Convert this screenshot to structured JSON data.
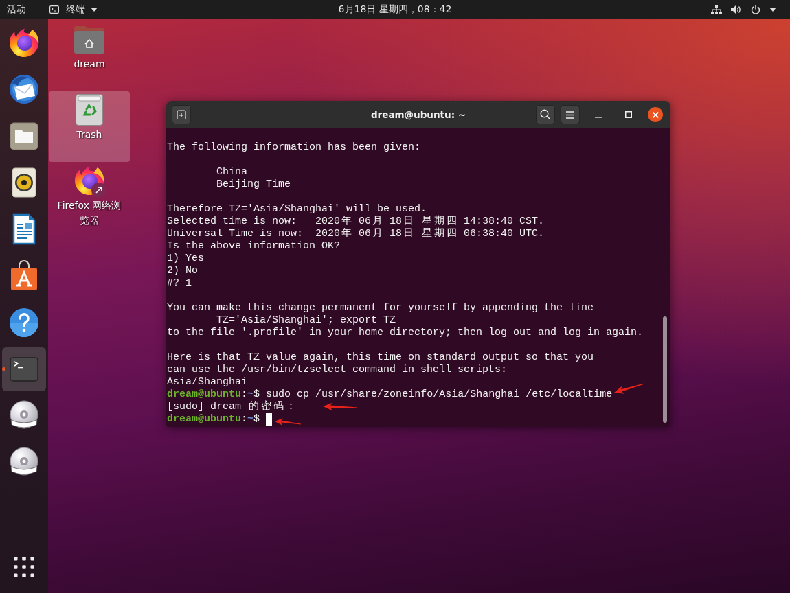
{
  "top_bar": {
    "activities": "活动",
    "app_menu": "终端",
    "clock": "6月18日 星期四，08：42"
  },
  "dock": {
    "items": [
      {
        "running": false,
        "focused": false
      },
      {
        "running": false,
        "focused": false
      },
      {
        "running": false,
        "focused": false
      },
      {
        "running": false,
        "focused": false
      },
      {
        "running": false,
        "focused": false
      },
      {
        "running": false,
        "focused": false
      },
      {
        "running": false,
        "focused": false
      },
      {
        "running": true,
        "focused": true
      },
      {
        "running": false,
        "focused": false
      },
      {
        "running": false,
        "focused": false
      }
    ]
  },
  "desktop": {
    "icons": [
      {
        "label": "dream",
        "selected": false
      },
      {
        "label": "Trash",
        "selected": true
      },
      {
        "label": "Firefox 网络浏览器",
        "selected": false
      }
    ]
  },
  "terminal": {
    "title": "dream@ubuntu: ~",
    "lines": [
      {
        "kind": "output",
        "text": "The following information has been given:"
      },
      {
        "kind": "blank"
      },
      {
        "kind": "output",
        "text": "        China"
      },
      {
        "kind": "output",
        "text": "        Beijing Time"
      },
      {
        "kind": "blank"
      },
      {
        "kind": "output",
        "text": "Therefore TZ='Asia/Shanghai' will be used."
      },
      {
        "kind": "output",
        "text": "Selected time is now:   2020年 06月 18日 星期四 14:38:40 CST."
      },
      {
        "kind": "output",
        "text": "Universal Time is now:  2020年 06月 18日 星期四 06:38:40 UTC."
      },
      {
        "kind": "output",
        "text": "Is the above information OK?"
      },
      {
        "kind": "output",
        "text": "1) Yes"
      },
      {
        "kind": "output",
        "text": "2) No"
      },
      {
        "kind": "output",
        "text": "#? 1"
      },
      {
        "kind": "blank"
      },
      {
        "kind": "output",
        "text": "You can make this change permanent for yourself by appending the line"
      },
      {
        "kind": "output",
        "text": "        TZ='Asia/Shanghai'; export TZ"
      },
      {
        "kind": "output",
        "text": "to the file '.profile' in your home directory; then log out and log in again."
      },
      {
        "kind": "blank"
      },
      {
        "kind": "output",
        "text": "Here is that TZ value again, this time on standard output so that you"
      },
      {
        "kind": "output",
        "text": "can use the /usr/bin/tzselect command in shell scripts:"
      },
      {
        "kind": "output",
        "text": "Asia/Shanghai"
      },
      {
        "kind": "prompt",
        "user_host": "dream@ubuntu",
        "separator": ":",
        "path": "~",
        "symbol": "$",
        "command": "sudo cp /usr/share/zoneinfo/Asia/Shanghai /etc/localtime",
        "cursor": false
      },
      {
        "kind": "output",
        "text": "[sudo] dream 的密码："
      },
      {
        "kind": "prompt",
        "user_host": "dream@ubuntu",
        "separator": ":",
        "path": "~",
        "symbol": "$",
        "cursor": true
      }
    ]
  }
}
